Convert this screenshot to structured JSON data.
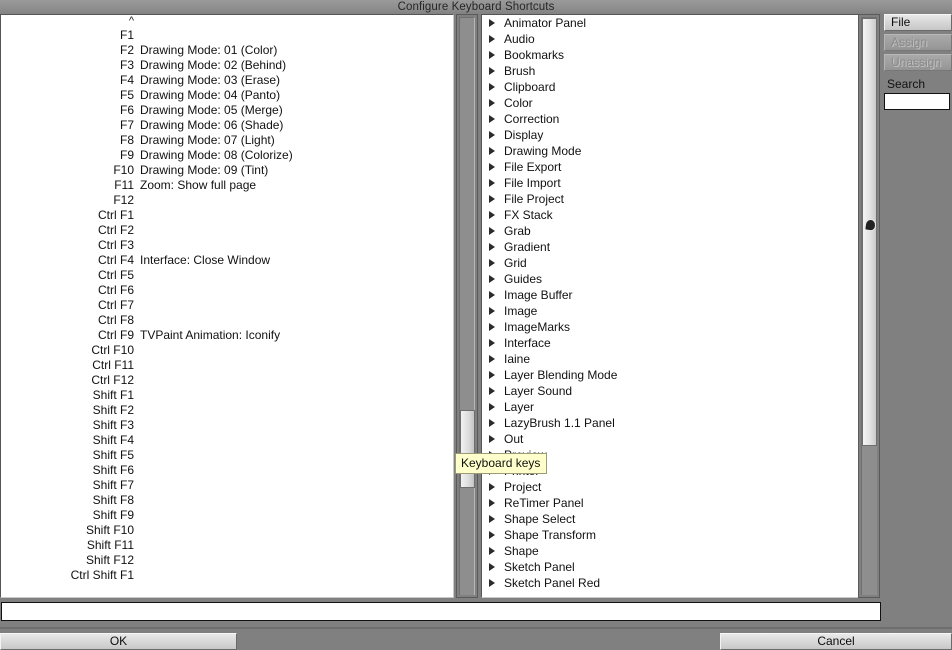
{
  "window": {
    "title": "Configure Keyboard Shortcuts"
  },
  "shortcuts_panel": {
    "top_marker": "^",
    "rows": [
      {
        "key": "F1",
        "command": ""
      },
      {
        "key": "F2",
        "command": "Drawing Mode: 01 (Color)"
      },
      {
        "key": "F3",
        "command": "Drawing Mode: 02 (Behind)"
      },
      {
        "key": "F4",
        "command": "Drawing Mode: 03 (Erase)"
      },
      {
        "key": "F5",
        "command": "Drawing Mode: 04 (Panto)"
      },
      {
        "key": "F6",
        "command": "Drawing Mode: 05 (Merge)"
      },
      {
        "key": "F7",
        "command": "Drawing Mode: 06 (Shade)"
      },
      {
        "key": "F8",
        "command": "Drawing Mode: 07 (Light)"
      },
      {
        "key": "F9",
        "command": "Drawing Mode: 08 (Colorize)"
      },
      {
        "key": "F10",
        "command": "Drawing Mode: 09 (Tint)"
      },
      {
        "key": "F11",
        "command": "Zoom: Show full page"
      },
      {
        "key": "F12",
        "command": ""
      },
      {
        "key": "Ctrl F1",
        "command": ""
      },
      {
        "key": "Ctrl F2",
        "command": ""
      },
      {
        "key": "Ctrl F3",
        "command": ""
      },
      {
        "key": "Ctrl F4",
        "command": "Interface: Close Window"
      },
      {
        "key": "Ctrl F5",
        "command": ""
      },
      {
        "key": "Ctrl F6",
        "command": ""
      },
      {
        "key": "Ctrl F7",
        "command": ""
      },
      {
        "key": "Ctrl F8",
        "command": ""
      },
      {
        "key": "Ctrl F9",
        "command": "TVPaint Animation: Iconify"
      },
      {
        "key": "Ctrl F10",
        "command": ""
      },
      {
        "key": "Ctrl F11",
        "command": ""
      },
      {
        "key": "Ctrl F12",
        "command": ""
      },
      {
        "key": "Shift F1",
        "command": ""
      },
      {
        "key": "Shift F2",
        "command": ""
      },
      {
        "key": "Shift F3",
        "command": ""
      },
      {
        "key": "Shift F4",
        "command": ""
      },
      {
        "key": "Shift F5",
        "command": ""
      },
      {
        "key": "Shift F6",
        "command": ""
      },
      {
        "key": "Shift F7",
        "command": ""
      },
      {
        "key": "Shift F8",
        "command": ""
      },
      {
        "key": "Shift F9",
        "command": ""
      },
      {
        "key": "Shift F10",
        "command": ""
      },
      {
        "key": "Shift F11",
        "command": ""
      },
      {
        "key": "Shift F12",
        "command": ""
      },
      {
        "key": "Ctrl Shift F1",
        "command": ""
      }
    ]
  },
  "commands_tree": {
    "items": [
      {
        "label": "Animator Panel"
      },
      {
        "label": "Audio"
      },
      {
        "label": "Bookmarks"
      },
      {
        "label": "Brush"
      },
      {
        "label": "Clipboard"
      },
      {
        "label": "Color"
      },
      {
        "label": "Correction"
      },
      {
        "label": "Display"
      },
      {
        "label": "Drawing Mode"
      },
      {
        "label": "File Export"
      },
      {
        "label": "File Import"
      },
      {
        "label": "File Project"
      },
      {
        "label": "FX Stack"
      },
      {
        "label": "Grab"
      },
      {
        "label": "Gradient"
      },
      {
        "label": "Grid"
      },
      {
        "label": "Guides"
      },
      {
        "label": "Image Buffer"
      },
      {
        "label": "Image"
      },
      {
        "label": "ImageMarks"
      },
      {
        "label": "Interface"
      },
      {
        "label": "Iaine"
      },
      {
        "label": "Layer Blending Mode"
      },
      {
        "label": "Layer Sound"
      },
      {
        "label": "Layer"
      },
      {
        "label": "LazyBrush 1.1 Panel"
      },
      {
        "label": "Out"
      },
      {
        "label": "Preview"
      },
      {
        "label": "Printer"
      },
      {
        "label": "Project"
      },
      {
        "label": "ReTimer Panel"
      },
      {
        "label": "Shape Select"
      },
      {
        "label": "Shape Transform"
      },
      {
        "label": "Shape"
      },
      {
        "label": "Sketch Panel"
      },
      {
        "label": "Sketch Panel Red"
      }
    ]
  },
  "tooltip": {
    "text": "Keyboard keys"
  },
  "side_panel": {
    "file_label": "File",
    "assign_label": "Assign",
    "unassign_label": "Unassign",
    "search_label": "Search",
    "search_value": ""
  },
  "bottom": {
    "value_field": "",
    "ok_label": "OK",
    "cancel_label": "Cancel"
  }
}
